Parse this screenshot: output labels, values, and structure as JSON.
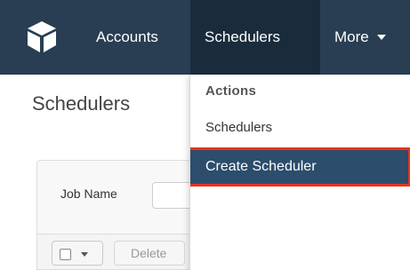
{
  "nav": {
    "accounts_label": "Accounts",
    "schedulers_label": "Schedulers",
    "more_label": "More"
  },
  "page": {
    "title": "Schedulers"
  },
  "filter": {
    "job_name_label": "Job Name",
    "job_name_value": ""
  },
  "actions": {
    "delete_label": "Delete"
  },
  "dropdown": {
    "header": "Actions",
    "items": [
      {
        "label": "Schedulers"
      },
      {
        "label": "Create Scheduler"
      }
    ]
  },
  "colors": {
    "navbar": "#293e53",
    "active_tab": "#1a2b3c",
    "menu_highlight": "#2c4d6c",
    "highlight_border": "#e8321f"
  }
}
